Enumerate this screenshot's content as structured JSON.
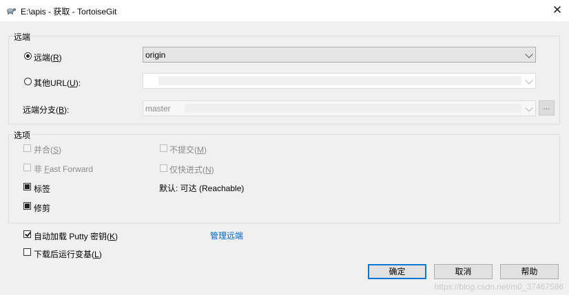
{
  "window": {
    "title": "E:\\apis - 获取 - TortoiseGit",
    "icon": "tortoise-icon",
    "close_glyph": "✕"
  },
  "remote_group": {
    "label": "远端",
    "remote_radio": {
      "label_prefix": "远端(",
      "accel": "R",
      "label_suffix": ")",
      "selected": true
    },
    "remote_select": {
      "value": "origin"
    },
    "other_url_radio": {
      "label_prefix": "其他URL(",
      "accel": "U",
      "label_suffix": "):",
      "selected": false
    },
    "other_url_input": {
      "value": ""
    },
    "branch": {
      "label_prefix": "远端分支(",
      "accel": "B",
      "label_suffix": "):",
      "value": "master",
      "browse_label": "..."
    }
  },
  "options_group": {
    "label": "选项",
    "merge": {
      "label_prefix": "并合(",
      "accel": "S",
      "label_suffix": ")",
      "checked": false,
      "disabled": true
    },
    "no_commit": {
      "label_prefix": "不提交(",
      "accel": "M",
      "label_suffix": ")",
      "checked": false,
      "disabled": true
    },
    "no_ff": {
      "label_prefix": "非 ",
      "accel": "F",
      "label_suffix": "ast Forward",
      "checked": false,
      "disabled": true
    },
    "ff_only": {
      "label_prefix": "仅快进式(",
      "accel": "N",
      "label_suffix": ")",
      "checked": false,
      "disabled": true
    },
    "tags": {
      "label": "标签",
      "state": "indeterminate"
    },
    "default_reachable": "默认: 可达 (Reachable)",
    "prune": {
      "label": "修剪",
      "state": "indeterminate"
    }
  },
  "autoload_putty": {
    "label_prefix": "自动加载 Putty 密钥(",
    "accel": "K",
    "label_suffix": ")",
    "checked": true
  },
  "manage_remotes_link": "管理远端",
  "run_rebase": {
    "label_prefix": "下载后运行变基(",
    "accel": "L",
    "label_suffix": ")",
    "checked": false
  },
  "buttons": {
    "ok": "确定",
    "cancel": "取消",
    "help": "帮助"
  },
  "watermark": "https://blog.csdn.net/m0_37467586",
  "colors": {
    "link": "#0066cc",
    "default_button_border": "#0078d7"
  }
}
